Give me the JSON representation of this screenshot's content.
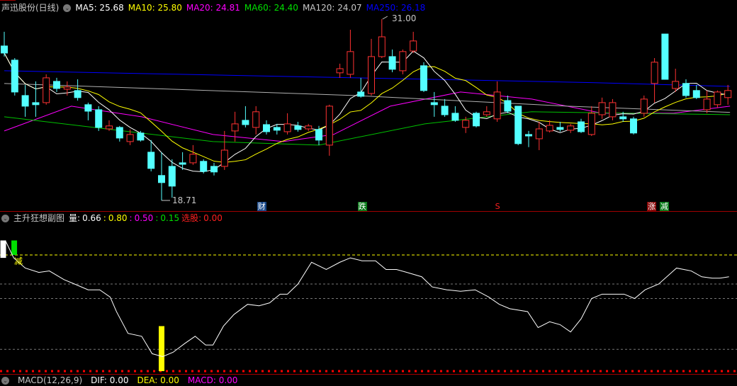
{
  "header": {
    "title": "声迅股份(日线)",
    "ma": [
      {
        "label": "MA5: 25.68",
        "color": "#ffffff"
      },
      {
        "label": "MA10: 25.80",
        "color": "#ffff00"
      },
      {
        "label": "MA20: 24.81",
        "color": "#ff00ff"
      },
      {
        "label": "MA60: 24.40",
        "color": "#00e000"
      },
      {
        "label": "MA120: 24.07",
        "color": "#c8c8c8"
      },
      {
        "label": "MA250: 26.18",
        "color": "#0000ff"
      }
    ]
  },
  "price_labels": {
    "high": "31.00",
    "low": "18.71"
  },
  "colors": {
    "up": "#ff3232",
    "down": "#54ffff",
    "bg": "#000000"
  },
  "candles": [
    [
      29.18,
      28.7,
      30.14,
      28.46
    ],
    [
      28.22,
      26.06,
      28.36,
      25.82
    ],
    [
      25.82,
      25.1,
      26.54,
      24.38
    ],
    [
      25.34,
      25.2,
      26.78,
      24.38
    ],
    [
      25.34,
      27.02,
      27.26,
      25.2
    ],
    [
      26.78,
      26.3,
      27.02,
      26.06
    ],
    [
      26.25,
      26.4,
      26.78,
      25.82
    ],
    [
      26.16,
      25.68,
      26.92,
      25.48
    ],
    [
      25.2,
      24.76,
      25.34,
      24.14
    ],
    [
      24.86,
      23.66,
      25.1,
      23.42
    ],
    [
      23.56,
      23.76,
      24.14,
      23.42
    ],
    [
      23.66,
      22.94,
      23.76,
      22.7
    ],
    [
      22.7,
      23.18,
      23.52,
      22.46
    ],
    [
      23.28,
      22.8,
      23.42,
      22.7
    ],
    [
      21.98,
      20.88,
      22.8,
      20.68
    ],
    [
      20.4,
      19.92,
      21.98,
      18.71
    ],
    [
      21.02,
      19.68,
      21.5,
      18.9
    ],
    [
      21.26,
      21.16,
      21.98,
      20.78
    ],
    [
      21.26,
      21.84,
      22.46,
      21.12
    ],
    [
      21.36,
      20.68,
      21.5,
      20.54
    ],
    [
      21.02,
      20.64,
      21.26,
      20.4
    ],
    [
      21.02,
      22.12,
      23.42,
      20.78
    ],
    [
      23.42,
      23.9,
      24.72,
      22.7
    ],
    [
      24.14,
      23.85,
      25.1,
      23.66
    ],
    [
      23.66,
      24.72,
      25.1,
      23.18
    ],
    [
      23.85,
      23.37,
      24.14,
      23.18
    ],
    [
      23.66,
      23.47,
      23.9,
      23.18
    ],
    [
      23.37,
      23.9,
      24.62,
      23.18
    ],
    [
      23.76,
      23.52,
      24.04,
      23.37
    ],
    [
      23.56,
      23.76,
      23.9,
      23.42
    ],
    [
      23.52,
      22.8,
      23.76,
      22.46
    ],
    [
      22.46,
      25.1,
      25.2,
      21.74
    ],
    [
      27.36,
      27.64,
      27.98,
      27.02
    ],
    [
      27.26,
      28.8,
      30.28,
      27.02
    ],
    [
      26.06,
      25.77,
      27.02,
      25.68
    ],
    [
      25.96,
      28.46,
      29.66,
      25.82
    ],
    [
      28.46,
      29.8,
      31.0,
      28.36
    ],
    [
      28.46,
      27.6,
      28.94,
      27.4
    ],
    [
      27.5,
      28.8,
      28.94,
      27.26
    ],
    [
      28.84,
      29.52,
      30.14,
      28.7
    ],
    [
      27.84,
      26.16,
      28.08,
      26.06
    ],
    [
      25.34,
      25.2,
      26.06,
      24.38
    ],
    [
      25.1,
      24.52,
      25.58,
      24.38
    ],
    [
      24.62,
      24.14,
      25.1,
      24.04
    ],
    [
      23.66,
      24.14,
      24.38,
      23.28
    ],
    [
      24.62,
      23.76,
      24.72,
      23.66
    ],
    [
      24.52,
      24.72,
      25.1,
      24.38
    ],
    [
      24.24,
      26.06,
      26.78,
      24.04
    ],
    [
      25.48,
      24.76,
      25.82,
      24.62
    ],
    [
      25.1,
      22.56,
      25.1,
      22.46
    ],
    [
      23.18,
      23.08,
      23.42,
      22.32
    ],
    [
      22.89,
      23.56,
      24.04,
      22.12
    ],
    [
      23.42,
      23.8,
      24.14,
      23.32
    ],
    [
      23.66,
      23.52,
      24.04,
      23.37
    ],
    [
      23.47,
      23.76,
      23.9,
      23.28
    ],
    [
      24.04,
      23.37,
      24.24,
      23.28
    ],
    [
      23.18,
      24.62,
      25.1,
      23.08
    ],
    [
      24.52,
      25.34,
      25.68,
      24.24
    ],
    [
      24.38,
      25.34,
      25.58,
      24.14
    ],
    [
      24.38,
      24.24,
      24.72,
      24.04
    ],
    [
      24.24,
      23.28,
      24.38,
      23.18
    ],
    [
      24.62,
      25.58,
      25.82,
      24.38
    ],
    [
      26.64,
      28.08,
      28.36,
      25.34
    ],
    [
      29.99,
      26.92,
      29.99,
      26.92
    ],
    [
      26.3,
      26.78,
      27.64,
      26.06
    ],
    [
      26.64,
      25.82,
      26.92,
      25.68
    ],
    [
      26.16,
      25.68,
      26.54,
      25.58
    ],
    [
      24.86,
      25.58,
      26.16,
      24.62
    ],
    [
      25.2,
      26.06,
      26.16,
      25.0
    ],
    [
      25.68,
      26.16,
      26.54,
      25.2
    ]
  ],
  "ma_lines": {
    "MA20": [
      [
        0,
        23.42
      ],
      [
        6.4,
        25.1
      ],
      [
        13.1,
        24.38
      ],
      [
        19.9,
        23.18
      ],
      [
        26.6,
        22.7
      ],
      [
        31.4,
        23.18
      ],
      [
        36.8,
        25.1
      ],
      [
        43.5,
        26.06
      ],
      [
        50.3,
        25.58
      ],
      [
        57,
        24.62
      ],
      [
        63.8,
        24.62
      ],
      [
        69.2,
        25.1
      ]
    ],
    "MA60": [
      [
        0,
        24.38
      ],
      [
        19.9,
        22.7
      ],
      [
        30,
        22.46
      ],
      [
        40.1,
        23.9
      ],
      [
        50.3,
        24.72
      ],
      [
        69.2,
        24.52
      ]
    ],
    "MA120": [
      [
        0,
        26.64
      ],
      [
        33.4,
        25.82
      ],
      [
        53.7,
        25.1
      ],
      [
        69.2,
        24.68
      ]
    ],
    "MA250": [
      [
        0,
        27.5
      ],
      [
        14,
        27.3
      ],
      [
        28,
        27.1
      ],
      [
        42,
        26.9
      ],
      [
        56,
        26.7
      ],
      [
        69.2,
        26.44
      ]
    ]
  },
  "markers": [
    {
      "label": "财",
      "bg": "#1a4a8a",
      "color": "#ffffff",
      "idx": 24.5
    },
    {
      "label": "跌",
      "bg": "#0a7a1a",
      "color": "#ffffff",
      "idx": 34.1
    },
    {
      "label": "S",
      "bg": "transparent",
      "color": "#ff2020",
      "idx": 47
    },
    {
      "label": "涨",
      "bg": "#8a0a0a",
      "color": "#ffffff",
      "idx": 61.7
    },
    {
      "label": "减",
      "bg": "#0a7a1a",
      "color": "#ffffff",
      "idx": 62.9
    }
  ],
  "sub": {
    "title": "主升狂想副图",
    "items": [
      {
        "label": "量:",
        "color": "#ffffff"
      },
      {
        "label": "0.66",
        "color": "#ffffff"
      },
      {
        "label": ":",
        "color": "#ffff00"
      },
      {
        "label": "0.80",
        "color": "#ffff00"
      },
      {
        "label": ":",
        "color": "#ff00ff"
      },
      {
        "label": "0.50",
        "color": "#ff00ff"
      },
      {
        "label": ":",
        "color": "#00e000"
      },
      {
        "label": "0.15",
        "color": "#00e000"
      },
      {
        "label": "选股:",
        "color": "#ff2020"
      },
      {
        "label": "0.00",
        "color": "#ff2020"
      }
    ],
    "signal_label": "减",
    "levels": [
      0.8,
      0.6,
      0.5,
      0.15,
      0.0
    ],
    "line": [
      [
        0.1,
        0.9
      ],
      [
        0.9,
        0.78
      ],
      [
        2.0,
        0.71
      ],
      [
        3.3,
        0.68
      ],
      [
        4.3,
        0.69
      ],
      [
        5.7,
        0.63
      ],
      [
        6.7,
        0.6
      ],
      [
        8.0,
        0.56
      ],
      [
        9.1,
        0.56
      ],
      [
        10.1,
        0.51
      ],
      [
        10.7,
        0.41
      ],
      [
        11.8,
        0.26
      ],
      [
        13.1,
        0.24
      ],
      [
        14.1,
        0.12
      ],
      [
        15.1,
        0.1
      ],
      [
        16.1,
        0.13
      ],
      [
        17.2,
        0.19
      ],
      [
        18.2,
        0.24
      ],
      [
        19.2,
        0.18
      ],
      [
        19.9,
        0.18
      ],
      [
        20.9,
        0.31
      ],
      [
        21.9,
        0.39
      ],
      [
        23.2,
        0.46
      ],
      [
        24.3,
        0.45
      ],
      [
        25.3,
        0.47
      ],
      [
        26.3,
        0.53
      ],
      [
        27.0,
        0.53
      ],
      [
        28.0,
        0.6
      ],
      [
        29.3,
        0.75
      ],
      [
        30.7,
        0.7
      ],
      [
        32.0,
        0.75
      ],
      [
        33.0,
        0.78
      ],
      [
        34.1,
        0.76
      ],
      [
        35.4,
        0.76
      ],
      [
        36.4,
        0.7
      ],
      [
        37.4,
        0.7
      ],
      [
        38.4,
        0.68
      ],
      [
        39.8,
        0.65
      ],
      [
        40.8,
        0.58
      ],
      [
        42.2,
        0.56
      ],
      [
        43.5,
        0.55
      ],
      [
        44.9,
        0.56
      ],
      [
        46.2,
        0.51
      ],
      [
        47.2,
        0.46
      ],
      [
        48.2,
        0.43
      ],
      [
        49.9,
        0.41
      ],
      [
        50.9,
        0.3
      ],
      [
        52.0,
        0.34
      ],
      [
        53.0,
        0.32
      ],
      [
        54.0,
        0.27
      ],
      [
        55.0,
        0.36
      ],
      [
        56.0,
        0.5
      ],
      [
        57.0,
        0.53
      ],
      [
        59.1,
        0.53
      ],
      [
        60.1,
        0.5
      ],
      [
        61.1,
        0.56
      ],
      [
        62.4,
        0.6
      ],
      [
        64.1,
        0.71
      ],
      [
        65.5,
        0.69
      ],
      [
        66.5,
        0.65
      ],
      [
        67.5,
        0.64
      ],
      [
        68.2,
        0.64
      ],
      [
        69.1,
        0.65
      ]
    ],
    "bars": [
      {
        "idx": -0.1,
        "top": 0.9,
        "bottom": 0.78,
        "color": "#ffffff"
      },
      {
        "idx": 0.95,
        "top": 0.9,
        "bottom": 0.8,
        "color": "#00e000"
      },
      {
        "idx": 15,
        "top": 0.31,
        "bottom": 0.0,
        "color": "#ffff00"
      }
    ]
  },
  "macd": {
    "title": "MACD(12,26,9)",
    "dif": "DIF: 0.00",
    "dea": "DEA: 0.00",
    "macd": "MACD: 0.00"
  }
}
